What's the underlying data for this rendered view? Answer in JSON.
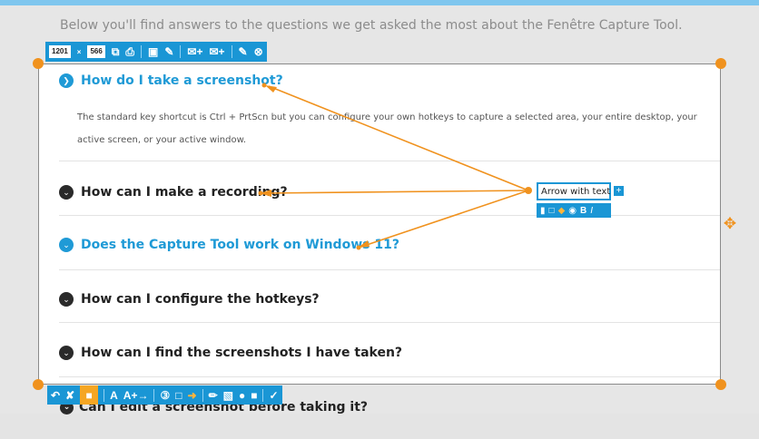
{
  "intro_text": "Below you'll find answers to the questions we get asked the most about the Fenêtre Capture Tool.",
  "capture_size": {
    "width": "1201",
    "height": "566",
    "separator": "×"
  },
  "faq": [
    {
      "question": "How do I take a screenshot?",
      "expanded": true,
      "answer": "The standard key shortcut is Ctrl + PrtScn but you can configure your own hotkeys to capture a selected area, your entire desktop, your active screen, or your active window."
    },
    {
      "question": "How can I make a recording?",
      "expanded": false
    },
    {
      "question": "Does the Capture Tool work on Windows 11?",
      "expanded": true
    },
    {
      "question": "How can I configure the hotkeys?",
      "expanded": false
    },
    {
      "question": "How can I find the screenshots I have taken?",
      "expanded": false
    }
  ],
  "behind_question": "Can I edit a screenshot before taking it?",
  "annotation": {
    "label": "Arrow with text",
    "tools": [
      "B",
      "I"
    ]
  },
  "top_toolbar_icons": [
    "copy-icon",
    "print-icon",
    "save-icon",
    "save-as-icon",
    "email-attach-icon",
    "email-image-icon",
    "edit-icon",
    "close-icon"
  ],
  "bottom_toolbar": {
    "text_tool": "A",
    "arrow_text_tool": "A+→",
    "number_tool": "3",
    "icons": [
      "undo-icon",
      "clear-icon",
      "lock-icon",
      "text-icon",
      "arrow-text-icon",
      "number-icon",
      "rectangle-icon",
      "arrow-icon",
      "pen-icon",
      "pixelate-icon",
      "blur-icon",
      "fill-icon",
      "highlighter-icon"
    ]
  },
  "colors": {
    "accent": "#1a96d5",
    "annotation": "#f0921e",
    "heading_open": "#1f9ad6"
  }
}
